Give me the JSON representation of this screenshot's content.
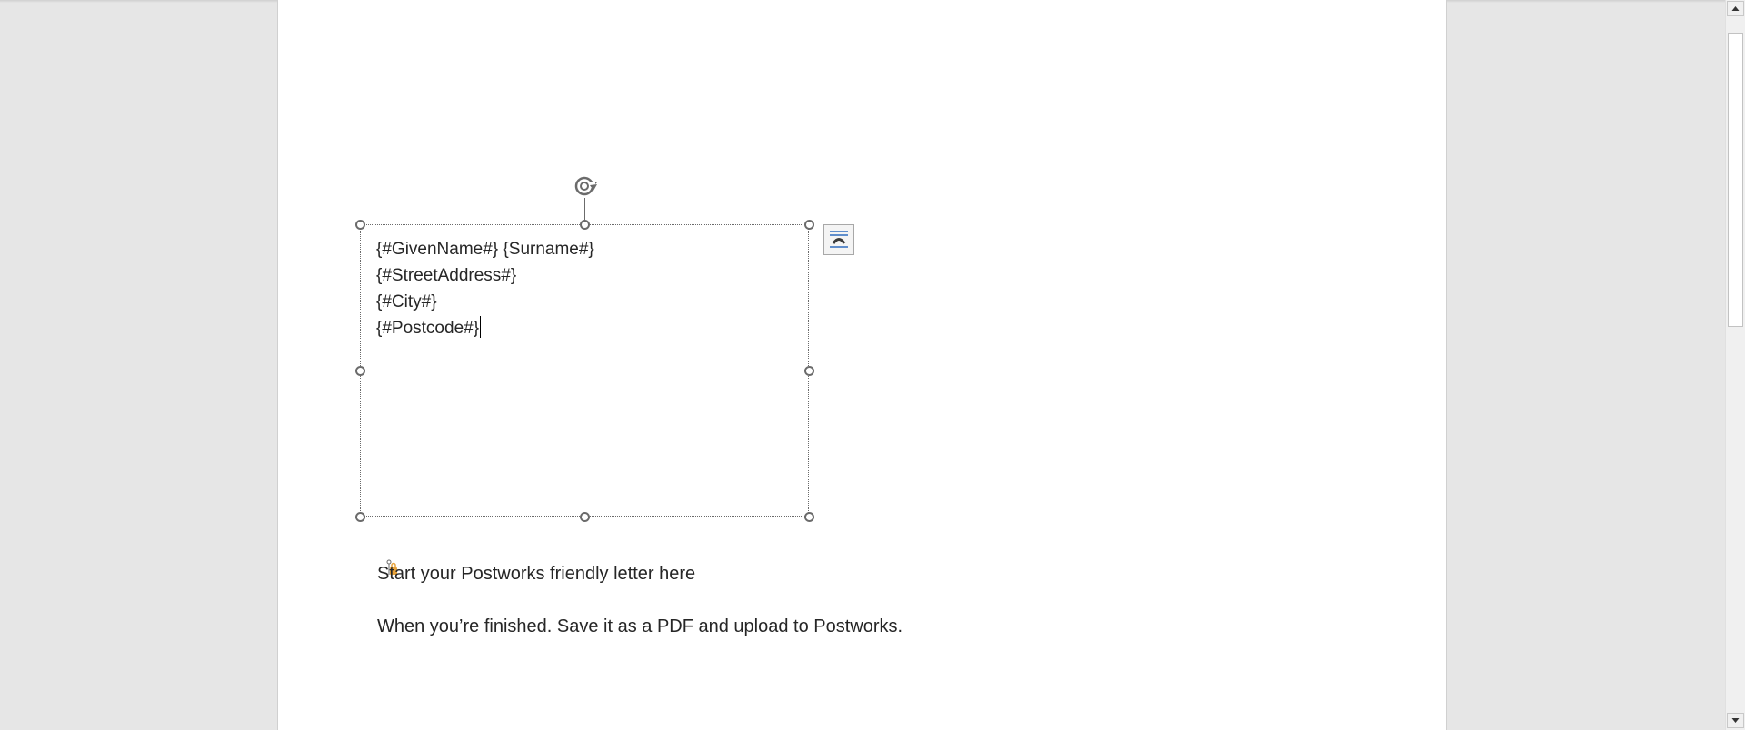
{
  "document": {
    "text_box": {
      "lines": [
        "{#GivenName#} {Surname#}",
        "{#StreetAddress#}",
        "{#City#}",
        "{#Postcode#}"
      ]
    },
    "paragraphs": [
      "Start your Postworks friendly letter here",
      "When you’re finished. Save it as a PDF and upload to Postworks."
    ]
  },
  "icons": {
    "rotate": "rotate-handle-icon",
    "layout_options": "layout-options-icon",
    "anchor": "anchor-icon",
    "scroll_up": "triangle-up-icon",
    "scroll_down": "triangle-down-icon"
  },
  "colors": {
    "workspace": "#e6e6e6",
    "page": "#ffffff",
    "text": "#262626",
    "handle": "#6b6b6b",
    "anchor_accent": "#e8a33b",
    "layout_line": "#2e6dbf"
  }
}
